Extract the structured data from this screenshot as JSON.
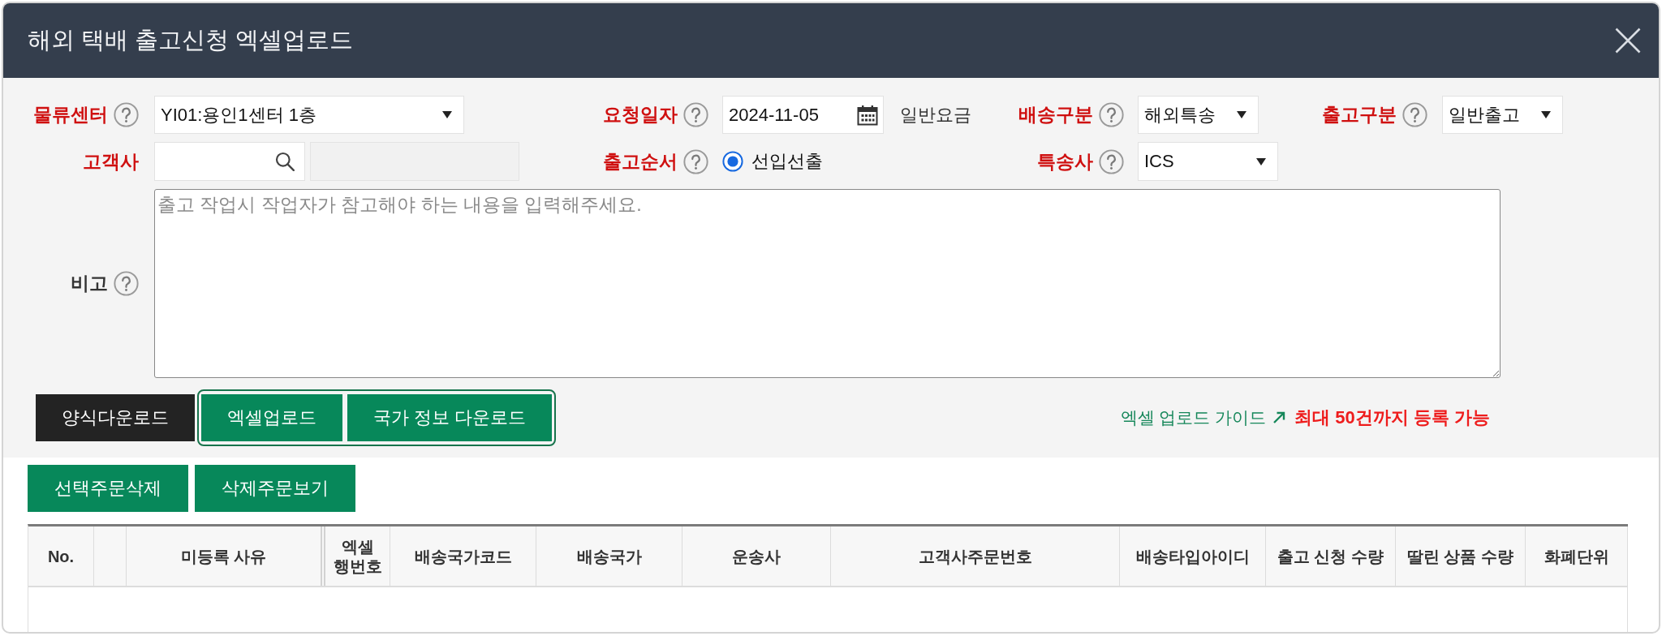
{
  "window": {
    "title": "해외 택배 출고신청 엑셀업로드"
  },
  "form": {
    "rows": [
      {
        "fields": [
          {
            "label": "물류센터",
            "required": true,
            "help": true,
            "kind": "select",
            "value": "YI01:용인1센터 1층"
          },
          {
            "label": "요청일자",
            "required": true,
            "help": true,
            "kind": "date",
            "value": "2024-11-05",
            "note": "일반요금"
          },
          {
            "label": "배송구분",
            "required": true,
            "help": true,
            "kind": "select",
            "value": "해외특송"
          },
          {
            "label": "출고구분",
            "required": true,
            "help": true,
            "kind": "select",
            "value": "일반출고"
          }
        ]
      },
      {
        "fields": [
          {
            "label": "고객사",
            "required": true,
            "help": false,
            "kind": "search",
            "name_field": {
              "disabled": true
            }
          },
          {
            "label": "출고순서",
            "required": true,
            "help": true,
            "kind": "radio",
            "options": [
              {
                "label": "선입선출",
                "selected": true
              }
            ]
          },
          {
            "label": "특송사",
            "required": true,
            "help": true,
            "kind": "select",
            "value": "ICS"
          }
        ]
      },
      {
        "fields": [
          {
            "label": "비고",
            "required": false,
            "help": true,
            "kind": "textarea",
            "placeholder": "출고 작업시 작업자가 참고해야 하는 내용을 입력해주세요."
          }
        ]
      }
    ]
  },
  "toolbar": {
    "buttons": [
      {
        "label": "양식다운로드",
        "kind": "dark"
      }
    ],
    "highlight": {
      "on": true,
      "buttons": [
        {
          "label": "엑셀업로드",
          "kind": "green"
        },
        {
          "label": "국가 정보 다운로드",
          "kind": "green"
        }
      ]
    },
    "guide_link": "엑셀 업로드 가이드",
    "limit_note": "최대 50건까지 등록 가능"
  },
  "order_actions": [
    {
      "label": "선택주문삭제"
    },
    {
      "label": "삭제주문보기"
    }
  ],
  "table": {
    "columns": [
      {
        "kind": "text",
        "label": "No."
      },
      {
        "kind": "blank"
      },
      {
        "kind": "text",
        "label": "미등록 사유"
      },
      {
        "kind": "text",
        "label": "엑셀 행번호"
      },
      {
        "kind": "text",
        "label": "배송국가코드"
      },
      {
        "kind": "text",
        "label": "배송국가"
      },
      {
        "kind": "text",
        "label": "운송사"
      },
      {
        "kind": "text",
        "label": "고객사주문번호"
      },
      {
        "kind": "text",
        "label": "배송타입아이디"
      },
      {
        "kind": "text",
        "label": "출고 신청 수량"
      },
      {
        "kind": "text",
        "label": "딸린 상품 수량"
      },
      {
        "kind": "text",
        "label": "화폐단위"
      }
    ]
  }
}
